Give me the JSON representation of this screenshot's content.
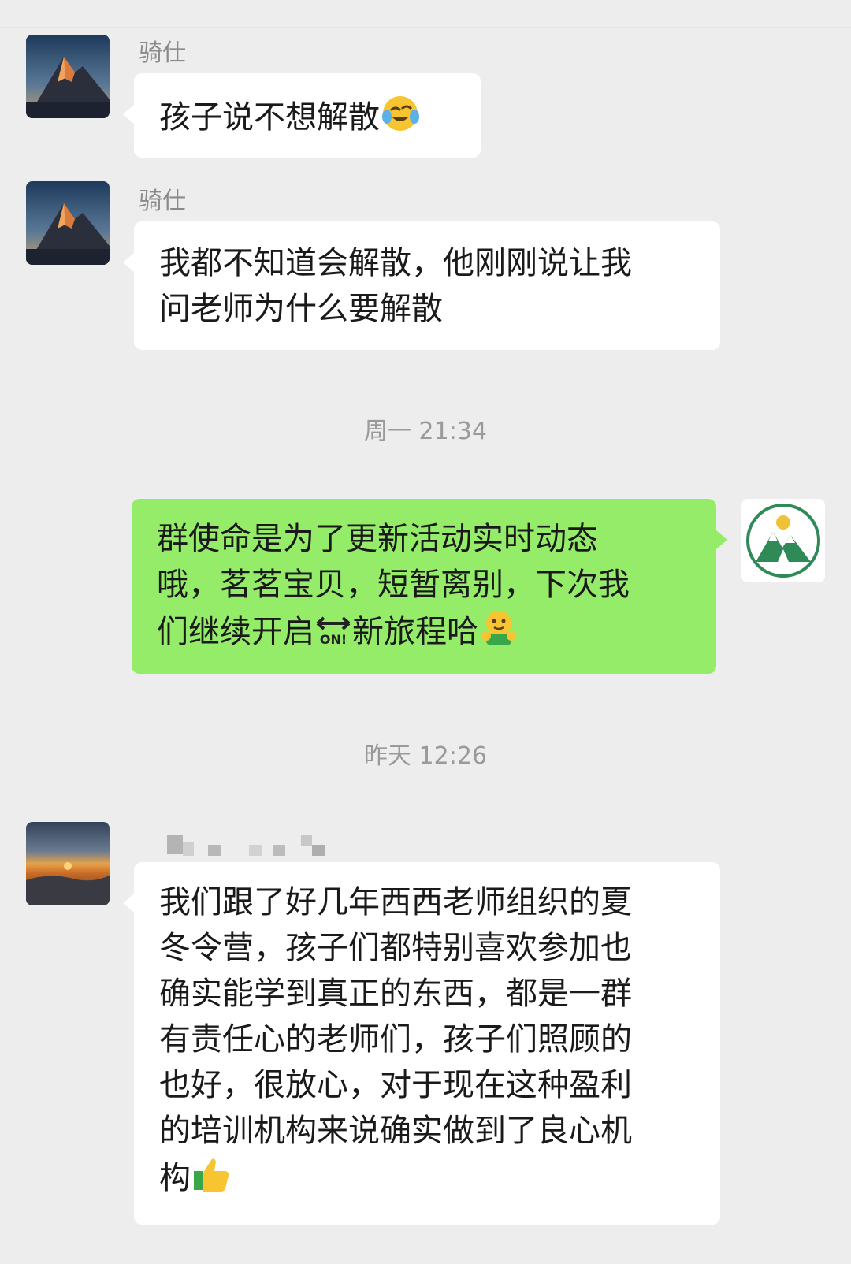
{
  "messages": [
    {
      "sender": "骑仕",
      "lines": [
        "孩子说不想解散"
      ],
      "emoji": "face-with-tears-of-joy-emoji"
    },
    {
      "sender": "骑仕",
      "lines": [
        "我都不知道会解散，他刚刚说让我",
        "问老师为什么要解散"
      ]
    },
    {
      "lines": [
        "群使命是为了更新活动实时动态",
        "哦，茗茗宝贝，短暂离别，下次我",
        "们继续开启",
        "新旅程哈"
      ],
      "emojis": [
        "on-arrow-emoji",
        "hugging-face-emoji"
      ]
    },
    {
      "lines": [
        "我们跟了好几年西西老师组织的夏",
        "冬令营，孩子们都特别喜欢参加也",
        "确实能学到真正的东西，都是一群",
        "有责任心的老师们，孩子们照顾的",
        "也好，很放心，对于现在这种盈利",
        "的培训机构来说确实做到了良心机",
        "构"
      ],
      "emoji": "thumbs-up-emoji"
    }
  ],
  "timestamps": [
    "周一 21:34",
    "昨天 12:26"
  ],
  "colors": {
    "background": "#ededed",
    "incoming_bubble": "#ffffff",
    "outgoing_bubble": "#95ec69",
    "meta_text": "#9a9a9a"
  }
}
